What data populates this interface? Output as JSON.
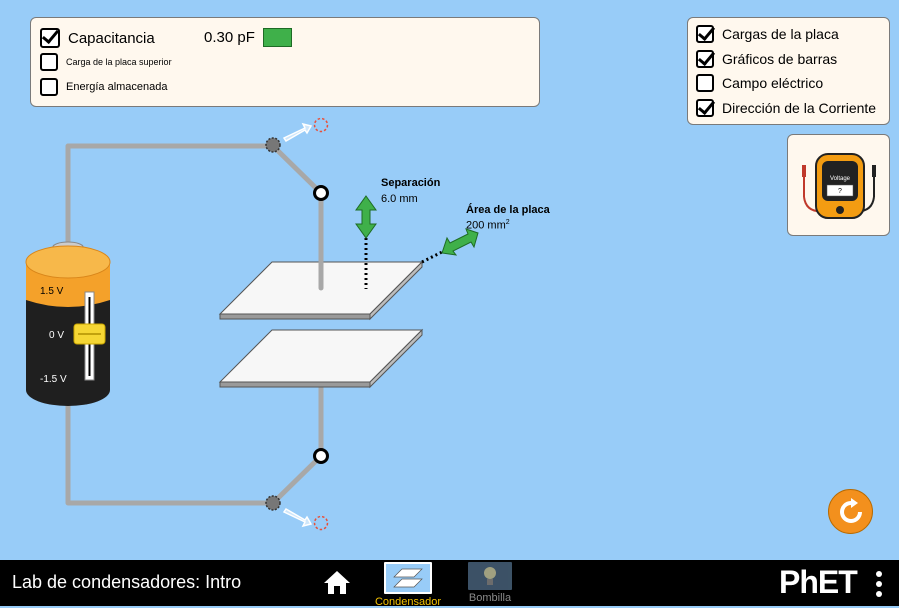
{
  "top_left_panel": {
    "capacitance": {
      "label": "Capacitancia",
      "checked": true,
      "value": "0.30 pF"
    },
    "top_plate_charge": {
      "label": "Carga de la placa superior",
      "checked": false
    },
    "stored_energy": {
      "label": "Energía almacenada",
      "checked": false
    }
  },
  "top_right_panel": {
    "items": [
      {
        "label": "Cargas de la placa",
        "checked": true
      },
      {
        "label": "Gráficos de barras",
        "checked": true
      },
      {
        "label": "Campo eléctrico",
        "checked": false
      },
      {
        "label": "Dirección de la Corriente",
        "checked": true
      }
    ]
  },
  "voltmeter": {
    "title": "Voltage",
    "reading": "?"
  },
  "battery": {
    "ticks": [
      "1.5 V",
      "0 V",
      "-1.5 V"
    ],
    "level": "0 V"
  },
  "separation": {
    "label": "Separación",
    "value": "6.0 mm"
  },
  "plate_area": {
    "label": "Área de la placa",
    "value": "200 mm",
    "unit_sup": "2"
  },
  "navbar": {
    "title": "Lab de condensadores: Intro",
    "tabs": [
      {
        "label": "Condensador",
        "selected": true
      },
      {
        "label": "Bombilla",
        "selected": false
      }
    ],
    "brand": "PhET"
  },
  "colors": {
    "background": "#98ccf8",
    "panel": "#fff8ee",
    "accent_green": "#3fb04a",
    "selected_tab": "#f3c100",
    "reset": "#f3901d"
  }
}
